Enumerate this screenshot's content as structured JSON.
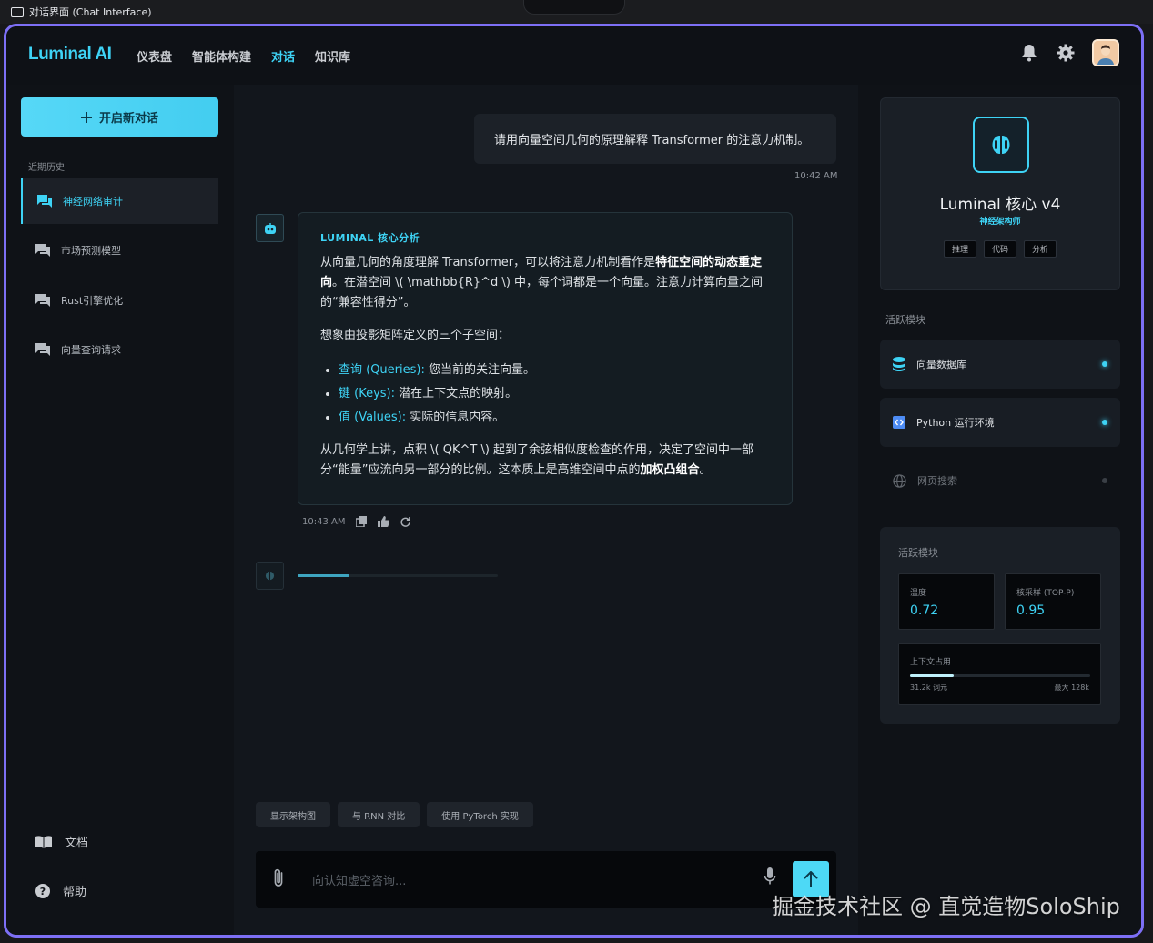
{
  "window": {
    "title": "对话界面 (Chat Interface)"
  },
  "header": {
    "logo": "Luminal AI",
    "nav": [
      {
        "label": "仪表盘"
      },
      {
        "label": "智能体构建"
      },
      {
        "label": "对话",
        "active": true
      },
      {
        "label": "知识库"
      }
    ],
    "icons": [
      "bell-icon",
      "gear-icon",
      "avatar"
    ]
  },
  "sidebar": {
    "new_chat_label": "开启新对话",
    "section_label": "近期历史",
    "history": [
      {
        "label": "神经网络审计",
        "active": true
      },
      {
        "label": "市场预测模型"
      },
      {
        "label": "Rust引擎优化"
      },
      {
        "label": "向量查询请求"
      }
    ],
    "footer": [
      {
        "label": "文档",
        "icon": "book-icon"
      },
      {
        "label": "帮助",
        "icon": "help-icon"
      }
    ]
  },
  "chat": {
    "user_message": "请用向量空间几何的原理解释 Transformer 的注意力机制。",
    "user_time": "10:42 AM",
    "bot_header": "LUMINAL 核心分析",
    "bot_p1_a": "从向量几何的角度理解 Transformer，可以将注意力机制看作是",
    "bot_p1_bold": "特征空间的动态重定向",
    "bot_p1_b": "。在潜空间 \\( \\mathbb{R}^d \\) 中，每个词都是一个向量。注意力计算向量之间的“兼容性得分”。",
    "bot_p2": "想象由投影矩阵定义的三个子空间：",
    "bullets": [
      {
        "key": "查询 (Queries):",
        "text": " 您当前的关注向量。"
      },
      {
        "key": "键 (Keys):",
        "text": " 潜在上下文点的映射。"
      },
      {
        "key": "值 (Values):",
        "text": " 实际的信息内容。"
      }
    ],
    "bot_p3_a": "从几何学上讲，点积 \\( QK^T \\) 起到了余弦相似度检查的作用，决定了空间中一部分“能量”应流向另一部分的比例。这本质上是高维空间中点的",
    "bot_p3_bold": "加权凸组合",
    "bot_p3_b": "。",
    "bot_time": "10:43 AM",
    "loading_progress": 0.26,
    "suggestions": [
      "显示架构图",
      "与 RNN 对比",
      "使用 PyTorch 实现"
    ],
    "input_placeholder": "向认知虚空咨询..."
  },
  "right": {
    "model_name": "Luminal 核心 v4",
    "model_role": "神经架构师",
    "tags": [
      "推理",
      "代码",
      "分析"
    ],
    "modules_title": "活跃模块",
    "modules": [
      {
        "label": "向量数据库",
        "status": "on",
        "icon": "database-icon",
        "color": "#3ed3f5"
      },
      {
        "label": "Python 运行环境",
        "status": "on",
        "icon": "code-icon",
        "color": "#3ed3f5"
      },
      {
        "label": "网页搜索",
        "status": "off",
        "icon": "globe-icon",
        "color": "#3a3f46"
      }
    ],
    "params_title": "活跃模块",
    "temperature_label": "温度",
    "temperature_value": "0.72",
    "top_p_label": "核采样 (TOP-P)",
    "top_p_value": "0.95",
    "context_label": "上下文占用",
    "context_used": "31.2k 词元",
    "context_max": "最大 128k",
    "context_fraction": 0.244
  },
  "watermark": "掘金技术社区 @ 直觉造物SoloShip",
  "colors": {
    "accent": "#3ed3f5",
    "frame": "#7d6ff5"
  }
}
